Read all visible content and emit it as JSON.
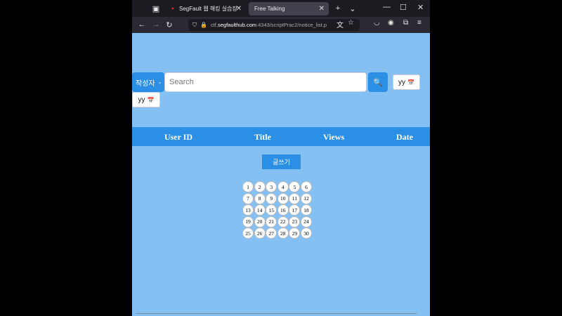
{
  "browser": {
    "tabs": [
      {
        "label": "SegFault 웹 해킹 실습장"
      },
      {
        "label": "Free Talking"
      }
    ],
    "url_prefix": "ctf.",
    "url_host": "segfaulthub.com",
    "url_rest": ":4343/scriptPrac2/notice_list.p"
  },
  "search": {
    "select_value": "작성자",
    "placeholder": "Search",
    "date_from": "yy",
    "date_to": "yy"
  },
  "table": {
    "headers": [
      "User ID",
      "Title",
      "Views",
      "Date"
    ]
  },
  "write_button": "글쓰기",
  "pages": [
    "1",
    "2",
    "3",
    "4",
    "5",
    "6",
    "7",
    "8",
    "9",
    "10",
    "11",
    "12",
    "13",
    "14",
    "15",
    "16",
    "17",
    "18",
    "19",
    "20",
    "21",
    "22",
    "23",
    "24",
    "25",
    "26",
    "27",
    "28",
    "29",
    "30"
  ]
}
